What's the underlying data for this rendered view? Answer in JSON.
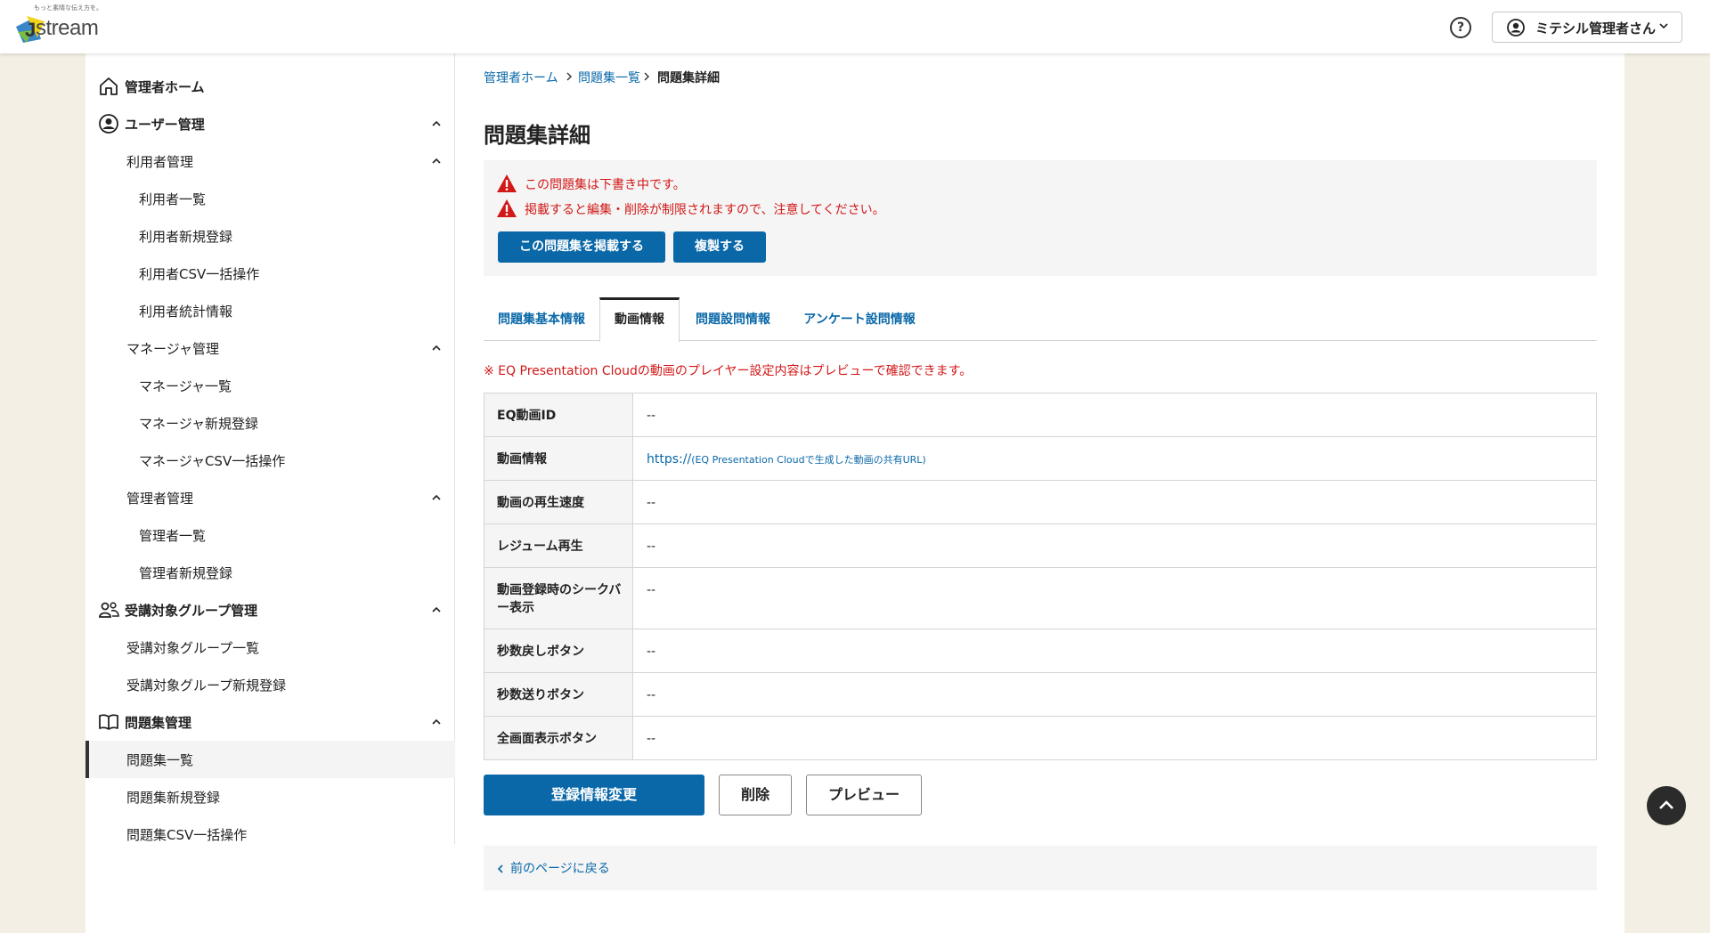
{
  "header": {
    "logo_tagline": "もっと素晴な伝え方を。",
    "logo_text": "stream",
    "user_name": "ミテシル管理者さん"
  },
  "sidebar": {
    "items": [
      {
        "label": "管理者ホーム",
        "level": 0,
        "icon": "home-icon"
      },
      {
        "label": "ユーザー管理",
        "level": 0,
        "icon": "user-circle-icon",
        "expanded": true
      },
      {
        "label": "利用者管理",
        "level": 1,
        "expanded": true
      },
      {
        "label": "利用者一覧",
        "level": 2
      },
      {
        "label": "利用者新規登録",
        "level": 2
      },
      {
        "label": "利用者CSV一括操作",
        "level": 2
      },
      {
        "label": "利用者統計情報",
        "level": 2
      },
      {
        "label": "マネージャ管理",
        "level": 1,
        "expanded": true
      },
      {
        "label": "マネージャ一覧",
        "level": 2
      },
      {
        "label": "マネージャ新規登録",
        "level": 2
      },
      {
        "label": "マネージャCSV一括操作",
        "level": 2
      },
      {
        "label": "管理者管理",
        "level": 1,
        "expanded": true
      },
      {
        "label": "管理者一覧",
        "level": 2
      },
      {
        "label": "管理者新規登録",
        "level": 2
      },
      {
        "label": "受講対象グループ管理",
        "level": 0,
        "icon": "group-icon",
        "expanded": true
      },
      {
        "label": "受講対象グループ一覧",
        "level": 1
      },
      {
        "label": "受講対象グループ新規登録",
        "level": 1
      },
      {
        "label": "問題集管理",
        "level": 0,
        "icon": "book-icon",
        "expanded": true
      },
      {
        "label": "問題集一覧",
        "level": 1,
        "active": true
      },
      {
        "label": "問題集新規登録",
        "level": 1
      },
      {
        "label": "問題集CSV一括操作",
        "level": 1
      }
    ]
  },
  "breadcrumb": [
    "管理者ホーム",
    "問題集一覧",
    "問題集詳細"
  ],
  "page_title": "問題集詳細",
  "notice": {
    "lines": [
      "この問題集は下書き中です。",
      "掲載すると編集・削除が制限されますので、注意してください。"
    ],
    "publish_button": "この問題集を掲載する",
    "duplicate_button": "複製する"
  },
  "tabs": [
    "問題集基本情報",
    "動画情報",
    "問題設問情報",
    "アンケート設問情報"
  ],
  "active_tab": "動画情報",
  "note": "※ EQ Presentation Cloudの動画のプレイヤー設定内容はプレビューで確認できます。",
  "table": {
    "rows": [
      {
        "label": "EQ動画ID",
        "value": "--"
      },
      {
        "label": "動画情報",
        "value_link": "https://",
        "value_hint": "(EQ Presentation Cloudで生成した動画の共有URL)"
      },
      {
        "label": "動画の再生速度",
        "value": "--"
      },
      {
        "label": "レジューム再生",
        "value": "--"
      },
      {
        "label": "動画登録時のシークバー表示",
        "value": "--"
      },
      {
        "label": "秒数戻しボタン",
        "value": "--"
      },
      {
        "label": "秒数送りボタン",
        "value": "--"
      },
      {
        "label": "全画面表示ボタン",
        "value": "--"
      }
    ]
  },
  "actions": {
    "edit": "登録情報変更",
    "delete": "削除",
    "preview": "プレビュー"
  },
  "back_link": "前のページに戻る",
  "colors": {
    "primary": "#0a68a8",
    "warning": "#d21818",
    "page_bg": "#f3efe5"
  }
}
